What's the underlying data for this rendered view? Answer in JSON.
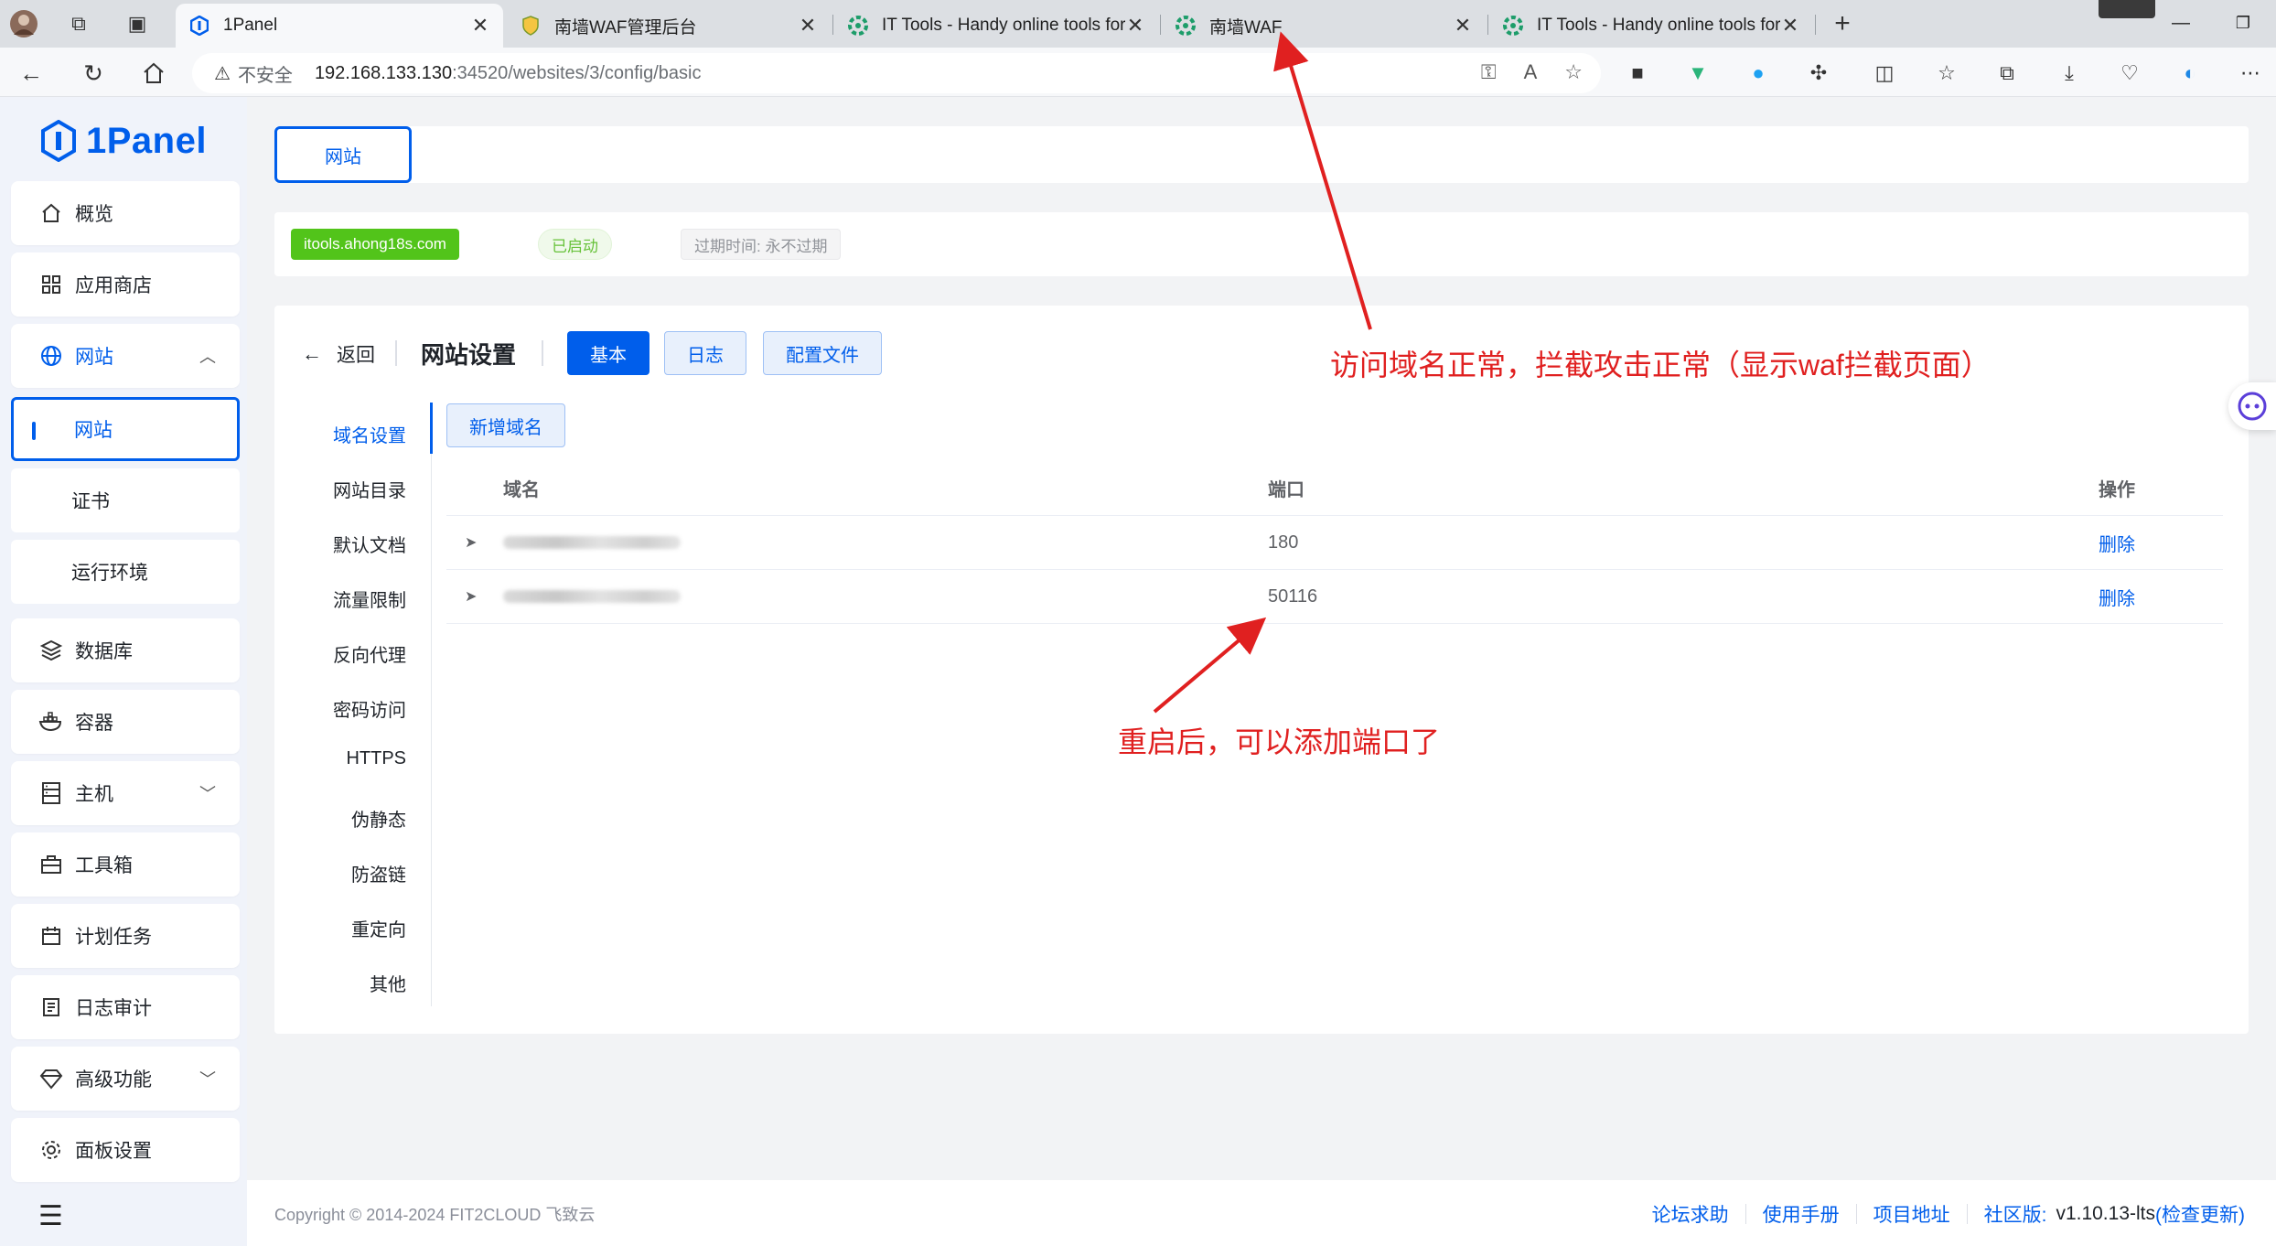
{
  "browser": {
    "tabs": [
      {
        "title": "1Panel",
        "active": true
      },
      {
        "title": "南墙WAF管理后台",
        "active": false
      },
      {
        "title": "IT Tools - Handy online tools for",
        "active": false
      },
      {
        "title": "南墙WAF",
        "active": false
      },
      {
        "title": "IT Tools - Handy online tools for",
        "active": false
      }
    ],
    "security_label": "不安全",
    "url_host": "192.168.133.130",
    "url_path": ":34520/websites/3/config/basic"
  },
  "sidebar": {
    "logo_text": "1Panel",
    "items": [
      {
        "label": "概览"
      },
      {
        "label": "应用商店"
      },
      {
        "label": "网站"
      },
      {
        "label": "网站"
      },
      {
        "label": "证书"
      },
      {
        "label": "运行环境"
      },
      {
        "label": "数据库"
      },
      {
        "label": "容器"
      },
      {
        "label": "主机"
      },
      {
        "label": "工具箱"
      },
      {
        "label": "计划任务"
      },
      {
        "label": "日志审计"
      },
      {
        "label": "高级功能"
      },
      {
        "label": "面板设置"
      }
    ]
  },
  "main": {
    "top_tab": "网站",
    "site": {
      "domain": "itools.ahong18s.com",
      "status": "已启动",
      "expire": "过期时间: 永不过期"
    },
    "header": {
      "back": "返回",
      "title": "网站设置",
      "tabs": [
        "基本",
        "日志",
        "配置文件"
      ]
    },
    "side_nav": [
      "域名设置",
      "网站目录",
      "默认文档",
      "流量限制",
      "反向代理",
      "密码访问",
      "HTTPS",
      "伪静态",
      "防盗链",
      "重定向",
      "其他"
    ],
    "add_domain": "新增域名",
    "table": {
      "columns": [
        "域名",
        "端口",
        "操作"
      ],
      "rows": [
        {
          "port": "180",
          "action": "删除"
        },
        {
          "port": "50116",
          "action": "删除"
        }
      ]
    }
  },
  "annotations": {
    "top": "访问域名正常，拦截攻击正常（显示waf拦截页面）",
    "middle": "重启后，可以添加端口了"
  },
  "footer": {
    "copyright": "Copyright © 2014-2024 FIT2CLOUD 飞致云",
    "links": [
      "论坛求助",
      "使用手册",
      "项目地址"
    ],
    "edition": "社区版:",
    "version": "v1.10.13-lts",
    "check_update": "(检查更新)"
  },
  "colors": {
    "primary": "#005eeb",
    "success": "#52c41a",
    "annotation": "#e02020"
  }
}
